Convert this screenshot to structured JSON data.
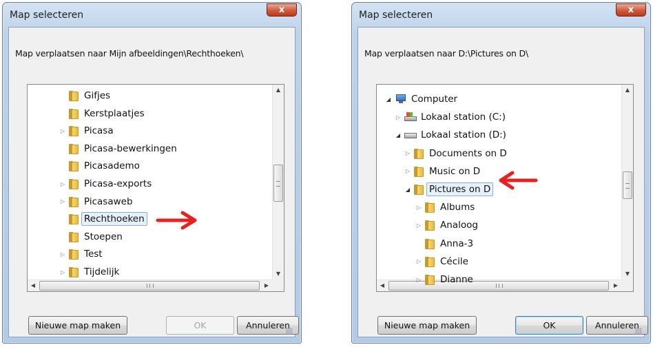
{
  "left_dialog": {
    "title": "Map selecteren",
    "close_label": "x",
    "instruction": "Map verplaatsen naar Mijn afbeeldingen\\Rechthoeken\\",
    "tree": [
      {
        "label": "Gifjes",
        "expandable": false,
        "selected": false
      },
      {
        "label": "Kerstplaatjes",
        "expandable": false,
        "selected": false
      },
      {
        "label": "Picasa",
        "expandable": true,
        "selected": false
      },
      {
        "label": "Picasa-bewerkingen",
        "expandable": false,
        "selected": false
      },
      {
        "label": "Picasademo",
        "expandable": false,
        "selected": false
      },
      {
        "label": "Picasa-exports",
        "expandable": true,
        "selected": false
      },
      {
        "label": "Picasaweb",
        "expandable": true,
        "selected": false
      },
      {
        "label": "Rechthoeken",
        "expandable": false,
        "selected": true
      },
      {
        "label": "Stoepen",
        "expandable": false,
        "selected": false
      },
      {
        "label": "Test",
        "expandable": true,
        "selected": false
      },
      {
        "label": "Tijdelijk",
        "expandable": true,
        "selected": false
      }
    ],
    "scrollbar_grip": "≡",
    "hscroll_grip": "III",
    "buttons": {
      "new_folder": "Nieuwe map maken",
      "ok": "OK",
      "cancel": "Annuleren"
    },
    "ok_enabled": false
  },
  "right_dialog": {
    "title": "Map selecteren",
    "close_label": "x",
    "instruction": "Map verplaatsen naar D:\\Pictures on D\\",
    "tree": [
      {
        "label": "Computer",
        "icon": "computer-icon",
        "level": 0,
        "expander": "expanded"
      },
      {
        "label": "Lokaal station (C:)",
        "icon": "drive-c-icon",
        "level": 1,
        "expander": "collapsed"
      },
      {
        "label": "Lokaal station (D:)",
        "icon": "drive-d-icon",
        "level": 1,
        "expander": "expanded"
      },
      {
        "label": "Documents on D",
        "icon": "folder-icon",
        "level": 2,
        "expander": "collapsed"
      },
      {
        "label": "Music on D",
        "icon": "folder-icon",
        "level": 2,
        "expander": "collapsed"
      },
      {
        "label": "Pictures on D",
        "icon": "folder-icon",
        "level": 2,
        "expander": "expanded",
        "selected": true
      },
      {
        "label": "Albums",
        "icon": "folder-icon",
        "level": 3,
        "expander": "collapsed"
      },
      {
        "label": "Analoog",
        "icon": "folder-icon",
        "level": 3,
        "expander": "collapsed"
      },
      {
        "label": "Anna-3",
        "icon": "folder-icon",
        "level": 3,
        "expander": "none"
      },
      {
        "label": "Cécile",
        "icon": "folder-icon",
        "level": 3,
        "expander": "collapsed"
      },
      {
        "label": "Dianne",
        "icon": "folder-icon",
        "level": 3,
        "expander": "collapsed"
      }
    ],
    "buttons": {
      "new_folder": "Nieuwe map maken",
      "ok": "OK",
      "cancel": "Annuleren"
    },
    "ok_enabled": true
  },
  "colors": {
    "arrow": "#e8201f",
    "close_button": "#cf5a3c",
    "selection_border": "#84acdd"
  }
}
